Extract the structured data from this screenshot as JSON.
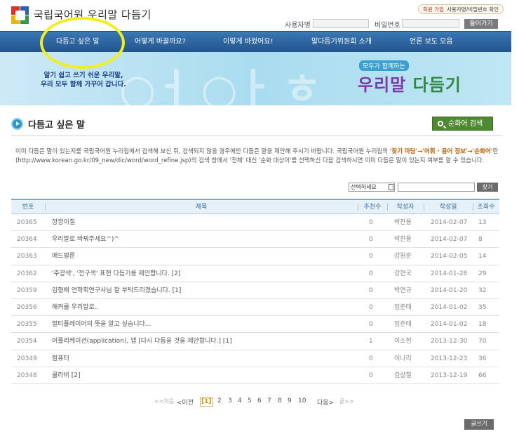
{
  "header": {
    "site_title": "국립국어원 우리말 다듬기",
    "join_label": "회원 가입",
    "find_label": "사용자명/비밀번호 확인",
    "username_label": "사용자명",
    "password_label": "비밀번호",
    "login_label": "들어가기"
  },
  "nav": {
    "items": [
      "다듬고 싶은 말",
      "어떻게 바꿀까요?",
      "이렇게 바꿨어요!",
      "말다듬기위원회 소개",
      "언론 보도 모음"
    ]
  },
  "banner": {
    "subtitle_line1": "알기 쉽고 쓰기 쉬운 우리말,",
    "subtitle_line2": "우리 모두 함께 가꾸어 갑니다.",
    "tag": "모두가 함께하는",
    "brand_1": "우리말",
    "brand_2": "다듬기"
  },
  "page": {
    "title": "다듬고 싶은 말",
    "search_pure_label": "순화어 검색",
    "desc_part1": "이미 다듬은 말이 있는지를 국립국어원 누리집에서 검색해 보신 뒤, 검색되지 않을 경우에만 다듬은 말을 제안해 주시기 바랍니다. 국립국어원 누리집의 ",
    "desc_highlight": "'찾기 마당'→'어휘 · 용어 정보'→'순화어'",
    "desc_part2": "란(http://www.korean.go.kr/09_new/dic/word/word_refine.jsp)의 검색 창에서 '전체' 대신 '순화 대상어'를 선택하신 다음 검색하시면 이미 다듬은 말이 있는지 여부를 알 수 있습니다.",
    "select_label": "선택하세요",
    "find_button": "찾기",
    "write_button": "글쓰기"
  },
  "table": {
    "headers": [
      "번호",
      "제목",
      "추천수",
      "작성자",
      "작성일",
      "조회수"
    ],
    "rows": [
      {
        "no": "20365",
        "title": "깡깡이질",
        "rec": "0",
        "author": "박찬용",
        "date": "2014-02-07",
        "views": "13"
      },
      {
        "no": "20364",
        "title": "우리말로 바꿔주세요^)^",
        "rec": "0",
        "author": "박찬용",
        "date": "2014-02-07",
        "views": "8"
      },
      {
        "no": "20363",
        "title": "애드벌룬",
        "rec": "0",
        "author": "강원준",
        "date": "2014-02-05",
        "views": "14"
      },
      {
        "no": "20362",
        "title": "'주광색', '전구색' 표현 다듬기를 제안합니다. [2]",
        "rec": "0",
        "author": "강현국",
        "date": "2014-01-28",
        "views": "29"
      },
      {
        "no": "20359",
        "title": "김형배 연학회연구사님 잘 부탁드리겠습니다. [1]",
        "rec": "0",
        "author": "박연규",
        "date": "2014-01-20",
        "views": "32"
      },
      {
        "no": "20356",
        "title": "해커를 우리말로..",
        "rec": "0",
        "author": "임준태",
        "date": "2014-01-02",
        "views": "35"
      },
      {
        "no": "20355",
        "title": "멀티플레이어의 뜻을 알고 싶습니다...",
        "rec": "0",
        "author": "임준태",
        "date": "2014-01-02",
        "views": "18"
      },
      {
        "no": "20354",
        "title": "어플리케이션(application), 앱 [다시 다듬을 것을 제안합니다.] [1]",
        "rec": "1",
        "author": "이소현",
        "date": "2013-12-30",
        "views": "70"
      },
      {
        "no": "20349",
        "title": "컴퓨터",
        "rec": "0",
        "author": "이나리",
        "date": "2013-12-23",
        "views": "36"
      },
      {
        "no": "20348",
        "title": "콜라비 [2]",
        "rec": "0",
        "author": "김상철",
        "date": "2013-12-19",
        "views": "66"
      }
    ]
  },
  "pager": {
    "first": "<<처음",
    "prev": "<이전",
    "current": "[1]",
    "pages": [
      "2",
      "3",
      "4",
      "5",
      "6",
      "7",
      "8",
      "9",
      "10"
    ],
    "next": "다음>",
    "last": "끝>>"
  },
  "colors": {
    "nav": "#2b64a0",
    "accent_green": "#4e8a32",
    "highlight_circle": "#f4ee1b"
  }
}
